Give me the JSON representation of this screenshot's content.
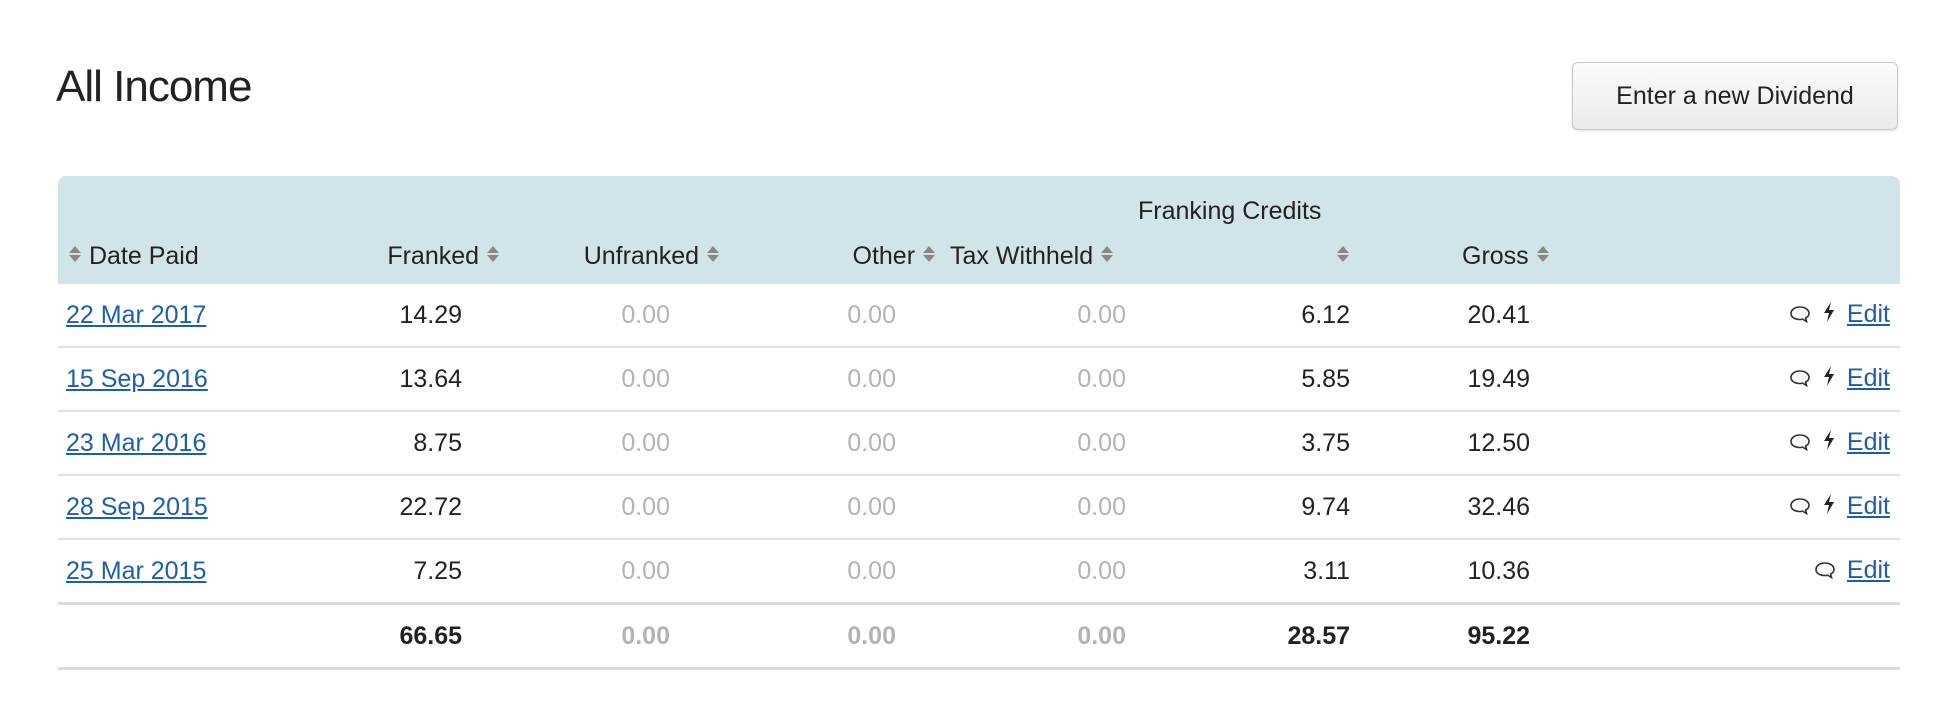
{
  "page": {
    "title": "All Income",
    "new_dividend_button": "Enter a new Dividend"
  },
  "table": {
    "group_header": "Franking Credits",
    "columns": {
      "date_paid": "Date Paid",
      "franked": "Franked",
      "unfranked": "Unfranked",
      "other": "Other",
      "tax_withheld": "Tax Withheld",
      "franking_credits": "",
      "gross": "Gross"
    },
    "rows": [
      {
        "date": "22 Mar 2017",
        "franked": "14.29",
        "unfranked": "0.00",
        "other": "0.00",
        "tax_withheld": "0.00",
        "franking_credits": "6.12",
        "gross": "20.41",
        "has_comment": true,
        "has_flash": true,
        "edit": "Edit"
      },
      {
        "date": "15 Sep 2016",
        "franked": "13.64",
        "unfranked": "0.00",
        "other": "0.00",
        "tax_withheld": "0.00",
        "franking_credits": "5.85",
        "gross": "19.49",
        "has_comment": true,
        "has_flash": true,
        "edit": "Edit"
      },
      {
        "date": "23 Mar 2016",
        "franked": "8.75",
        "unfranked": "0.00",
        "other": "0.00",
        "tax_withheld": "0.00",
        "franking_credits": "3.75",
        "gross": "12.50",
        "has_comment": true,
        "has_flash": true,
        "edit": "Edit"
      },
      {
        "date": "28 Sep 2015",
        "franked": "22.72",
        "unfranked": "0.00",
        "other": "0.00",
        "tax_withheld": "0.00",
        "franking_credits": "9.74",
        "gross": "32.46",
        "has_comment": true,
        "has_flash": true,
        "edit": "Edit"
      },
      {
        "date": "25 Mar 2015",
        "franked": "7.25",
        "unfranked": "0.00",
        "other": "0.00",
        "tax_withheld": "0.00",
        "franking_credits": "3.11",
        "gross": "10.36",
        "has_comment": true,
        "has_flash": false,
        "edit": "Edit"
      }
    ],
    "totals": {
      "franked": "66.65",
      "unfranked": "0.00",
      "other": "0.00",
      "tax_withheld": "0.00",
      "franking_credits": "28.57",
      "gross": "95.22"
    }
  },
  "colors": {
    "header_bg": "#d1e4ea",
    "link": "#1f5fa6",
    "muted_value": "#b3b3b3"
  },
  "icons": [
    "sort-icon",
    "comment-icon",
    "flash-icon"
  ]
}
